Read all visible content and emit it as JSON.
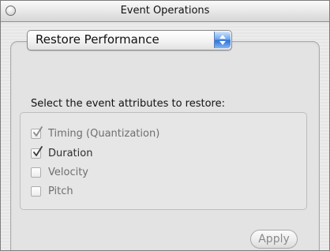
{
  "window": {
    "title": "Event Operations"
  },
  "operation_popup": {
    "selected": "Restore Performance"
  },
  "instruction": "Select the event attributes to restore:",
  "attributes": [
    {
      "label": "Timing (Quantization)",
      "checked": true,
      "enabled": false
    },
    {
      "label": "Duration",
      "checked": true,
      "enabled": true
    },
    {
      "label": "Velocity",
      "checked": false,
      "enabled": false
    },
    {
      "label": "Pitch",
      "checked": false,
      "enabled": false
    }
  ],
  "buttons": {
    "apply": "Apply"
  },
  "colors": {
    "window_bg": "#ececec",
    "popup_arrow_blue": "#2f74d8",
    "disabled_text": "#6f6f6f"
  },
  "icons": {
    "window_control": "round-window-control-icon",
    "popup_arrows": "up-down-arrows-icon",
    "checkmark": "checkmark-icon"
  }
}
